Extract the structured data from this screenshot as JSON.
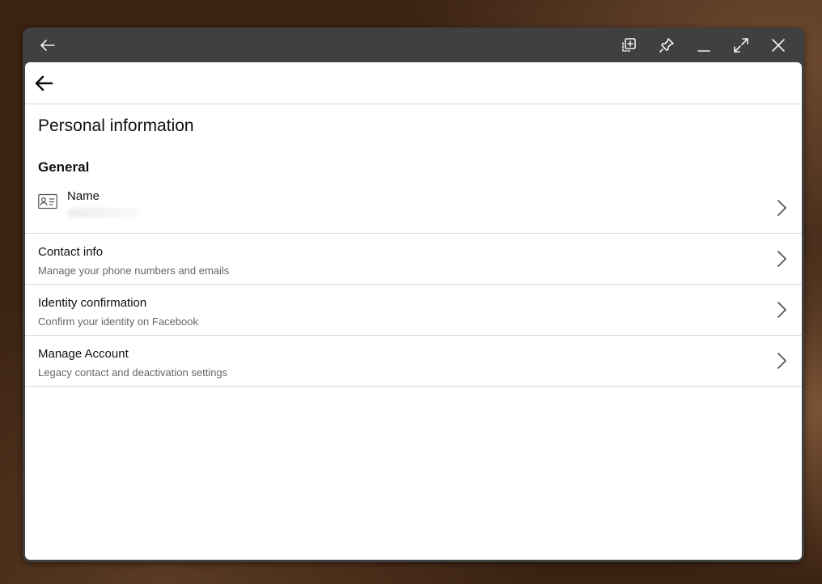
{
  "titlebar": {
    "icons": [
      "back-arrow-icon",
      "snapshot-icon",
      "pin-icon",
      "minimize-icon",
      "maximize-icon",
      "close-icon"
    ]
  },
  "page": {
    "title": "Personal information"
  },
  "general": {
    "heading": "General",
    "name_row": {
      "label": "Name",
      "icon": "id-card-icon"
    }
  },
  "rows": [
    {
      "title": "Contact info",
      "subtitle": "Manage your phone numbers and emails"
    },
    {
      "title": "Identity confirmation",
      "subtitle": "Confirm your identity on Facebook"
    },
    {
      "title": "Manage Account",
      "subtitle": "Legacy contact and deactivation settings"
    }
  ]
}
